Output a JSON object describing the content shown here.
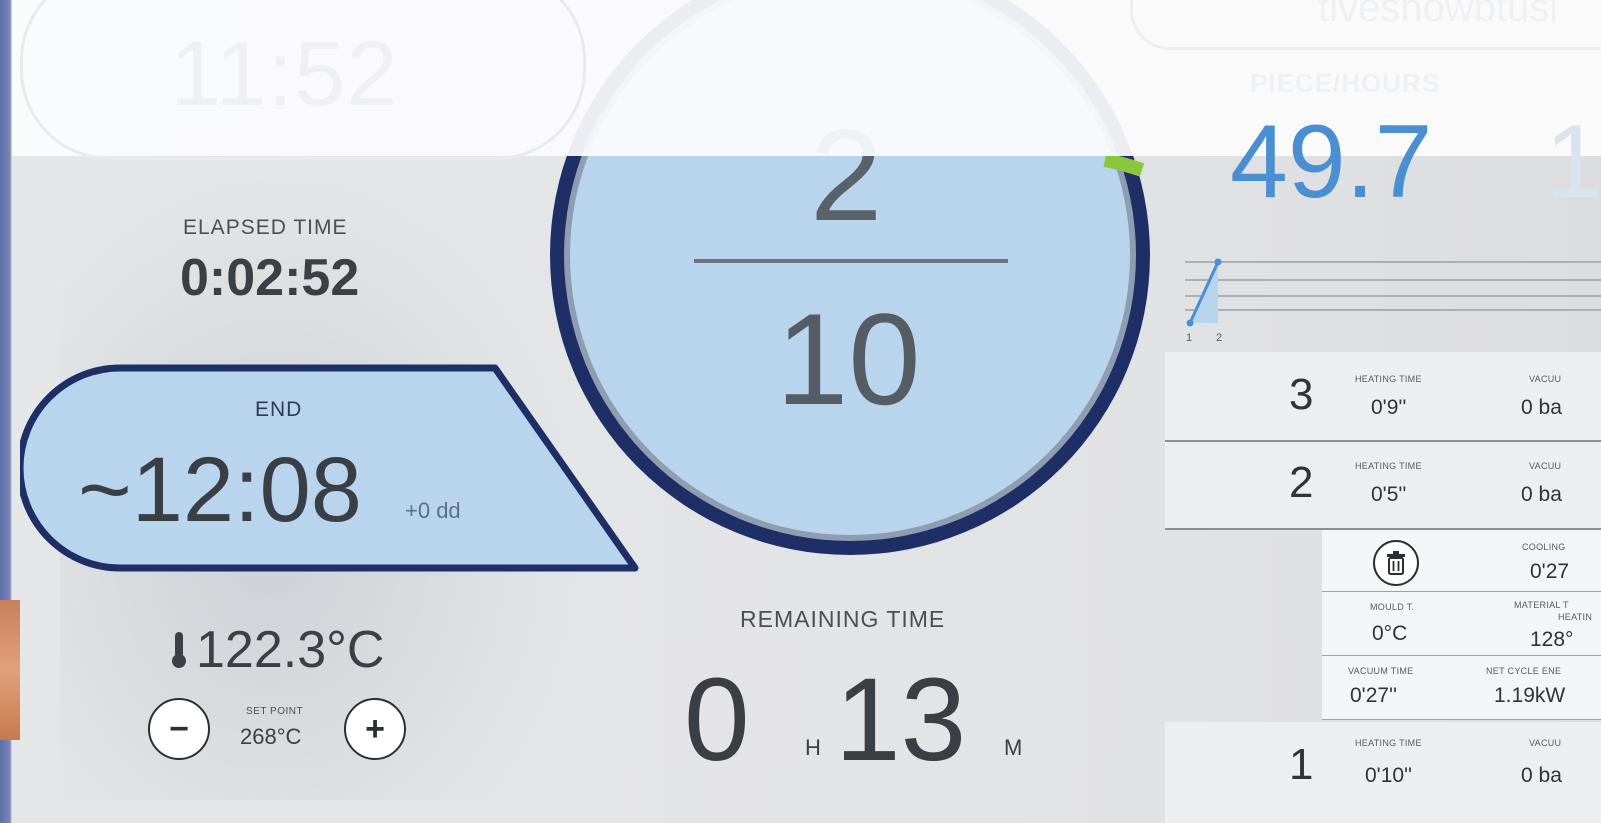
{
  "header": {
    "clock": "11:52",
    "top_right_text": "tiveshowbtusi",
    "piece_hours_label": "PIECE/HOURS",
    "piece_hours_value": "49.7",
    "piece_hours_partial": "1"
  },
  "elapsed": {
    "label": "ELAPSED TIME",
    "value": "0:02:52"
  },
  "end": {
    "label": "END",
    "value": "~12:08",
    "extra": "+0 dd"
  },
  "temperature": {
    "value": "122.3°C",
    "setpoint_label": "SET POINT",
    "setpoint_value": "268°C",
    "minus": "−",
    "plus": "+"
  },
  "cycle": {
    "current": "2",
    "total": "10",
    "progress_fraction": 0.2
  },
  "remaining": {
    "label": "REMAINING TIME",
    "hours": "0",
    "hours_unit": "H",
    "minutes": "13",
    "minutes_unit": "M"
  },
  "mini_chart": {
    "tick_labels": [
      "1",
      "2"
    ]
  },
  "rows": [
    {
      "num": "3",
      "heating_label": "HEATING TIME",
      "heating_value": "0'9''",
      "vacuum_label": "VACUU",
      "vacuum_value": "0 ba"
    },
    {
      "num": "2",
      "heating_label": "HEATING TIME",
      "heating_value": "0'5''",
      "vacuum_label": "VACUU",
      "vacuum_value": "0 ba"
    },
    {
      "num": "1",
      "heating_label": "HEATING TIME",
      "heating_value": "0'10''",
      "vacuum_label": "VACUU",
      "vacuum_value": "0 ba"
    }
  ],
  "details": {
    "cooling_label": "COOLING",
    "cooling_value": "0'27",
    "mould_label": "MOULD T.",
    "mould_value": "0°C",
    "material_label": "MATERIAL T",
    "material_sub": "HEATIN",
    "material_value": "128°",
    "vacuum_time_label": "VACUUM TIME",
    "vacuum_time_value": "0'27''",
    "net_cycle_label": "NET CYCLE ENE",
    "net_cycle_value": "1.19kW"
  },
  "colors": {
    "accent_blue": "#4a8fd1",
    "dark_navy": "#1d2f66",
    "light_blue_fill": "#b9d5ee",
    "progress_green": "#8cc63f"
  }
}
